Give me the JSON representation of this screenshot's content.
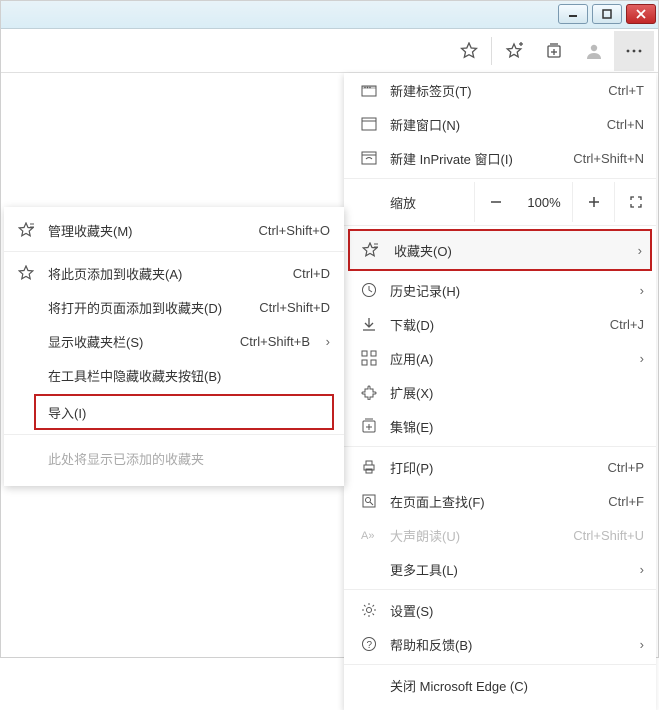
{
  "window_controls": {
    "minimize": "minimize",
    "maximize": "maximize",
    "close": "close"
  },
  "main_menu": {
    "new_tab": {
      "label": "新建标签页(T)",
      "shortcut": "Ctrl+T"
    },
    "new_window": {
      "label": "新建窗口(N)",
      "shortcut": "Ctrl+N"
    },
    "new_inprivate": {
      "label": "新建 InPrivate 窗口(I)",
      "shortcut": "Ctrl+Shift+N"
    },
    "zoom": {
      "label": "缩放",
      "value": "100%"
    },
    "favorites": {
      "label": "收藏夹(O)"
    },
    "history": {
      "label": "历史记录(H)"
    },
    "downloads": {
      "label": "下载(D)",
      "shortcut": "Ctrl+J"
    },
    "apps": {
      "label": "应用(A)"
    },
    "extensions": {
      "label": "扩展(X)"
    },
    "collections": {
      "label": "集锦(E)"
    },
    "print": {
      "label": "打印(P)",
      "shortcut": "Ctrl+P"
    },
    "find": {
      "label": "在页面上查找(F)",
      "shortcut": "Ctrl+F"
    },
    "read_aloud": {
      "label": "大声朗读(U)",
      "shortcut": "Ctrl+Shift+U"
    },
    "more_tools": {
      "label": "更多工具(L)"
    },
    "settings": {
      "label": "设置(S)"
    },
    "help": {
      "label": "帮助和反馈(B)"
    },
    "close_edge": {
      "label": "关闭 Microsoft Edge (C)"
    }
  },
  "favorites_submenu": {
    "manage": {
      "label": "管理收藏夹(M)",
      "shortcut": "Ctrl+Shift+O"
    },
    "add_page": {
      "label": "将此页添加到收藏夹(A)",
      "shortcut": "Ctrl+D"
    },
    "add_open": {
      "label": "将打开的页面添加到收藏夹(D)",
      "shortcut": "Ctrl+Shift+D"
    },
    "show_bar": {
      "label": "显示收藏夹栏(S)",
      "shortcut": "Ctrl+Shift+B"
    },
    "hide_button": {
      "label": "在工具栏中隐藏收藏夹按钮(B)"
    },
    "import": {
      "label": "导入(I)"
    },
    "empty_text": "此处将显示已添加的收藏夹"
  }
}
